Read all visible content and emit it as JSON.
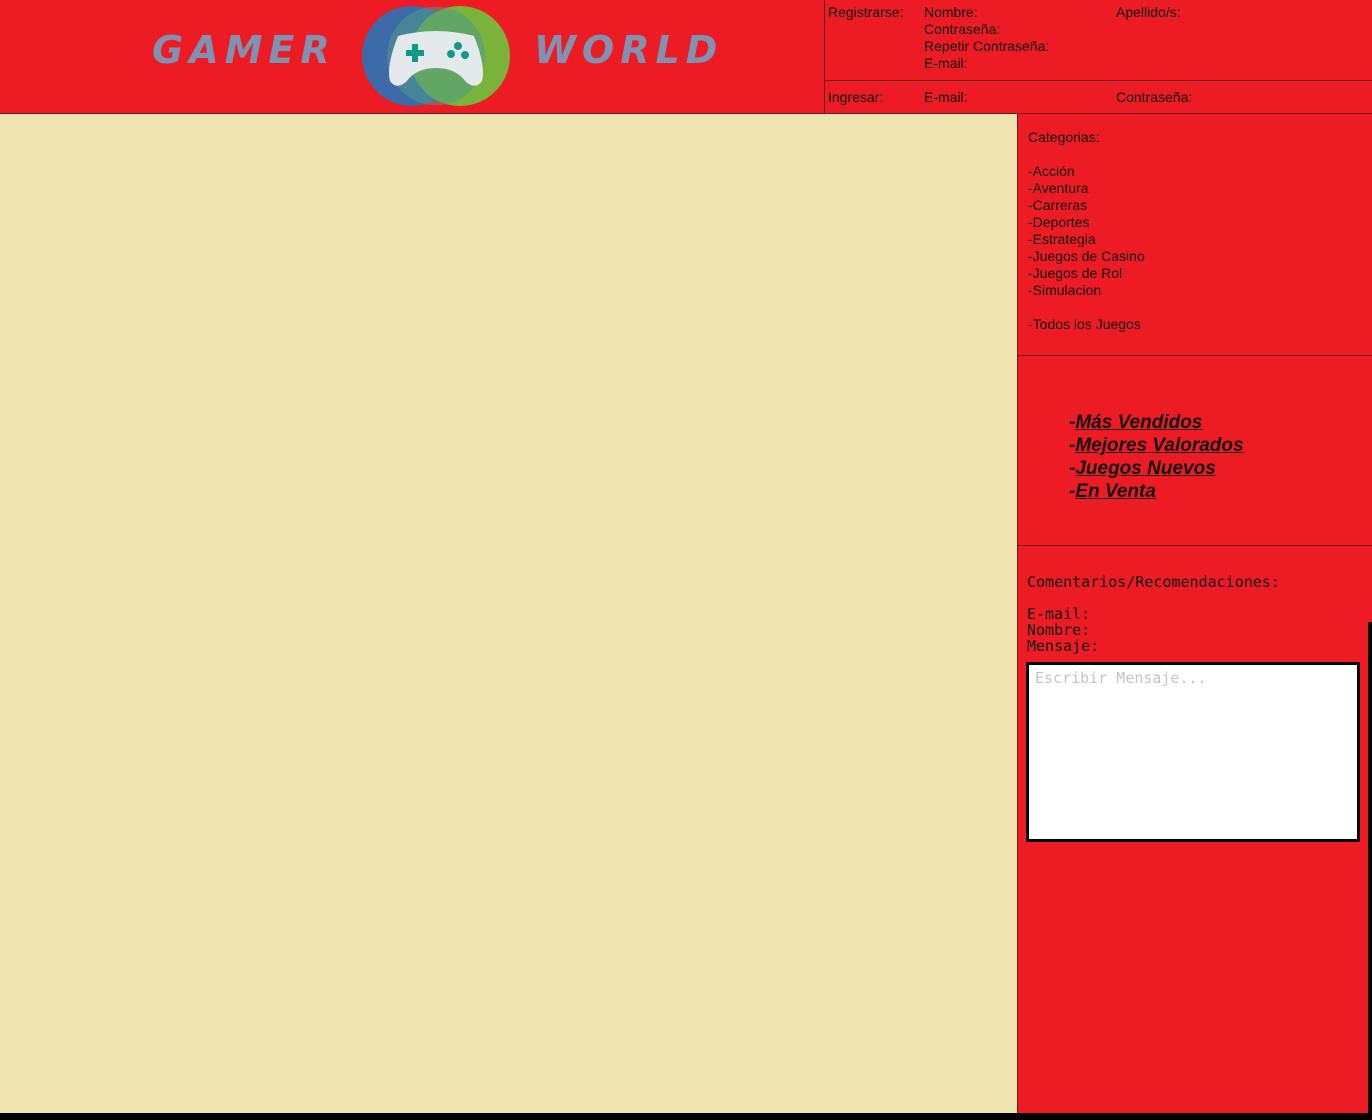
{
  "colors": {
    "accent": "#ed1c24",
    "content_bg": "#efe3b0",
    "logo_text": "#7f92b3"
  },
  "logo": {
    "word1": "GAMER",
    "word2": "WORLD",
    "emblem_icon": "gamepad-icon"
  },
  "register": {
    "label": "Registrarse:",
    "fields": [
      "Nombre:",
      "Contraseña:",
      "Repetir Contraseña:",
      "E-mail:"
    ],
    "surname": "Apellido/s:"
  },
  "login": {
    "label": "Ingresar:",
    "email": "E-mail:",
    "password": "Contraseña:"
  },
  "categories": {
    "title": "Categorias:",
    "items": [
      "-Acción",
      "-Aventura",
      "-Carreras",
      "-Deportes",
      "-Estrategia",
      "-Juegos de Casino",
      "-Juegos de Rol",
      "-Simulacion"
    ],
    "all": "-Todos los Juegos"
  },
  "featured": {
    "prefix": "-",
    "links": [
      "Más Vendidos",
      "Mejores Valorados",
      "Juegos Nuevos",
      "En Venta"
    ]
  },
  "comments": {
    "title": "Comentarios/Recomendaciones:",
    "email": "E-mail:",
    "name": "Nombre:",
    "message": "Mensaje:",
    "placeholder": "Escribir Mensaje..."
  }
}
